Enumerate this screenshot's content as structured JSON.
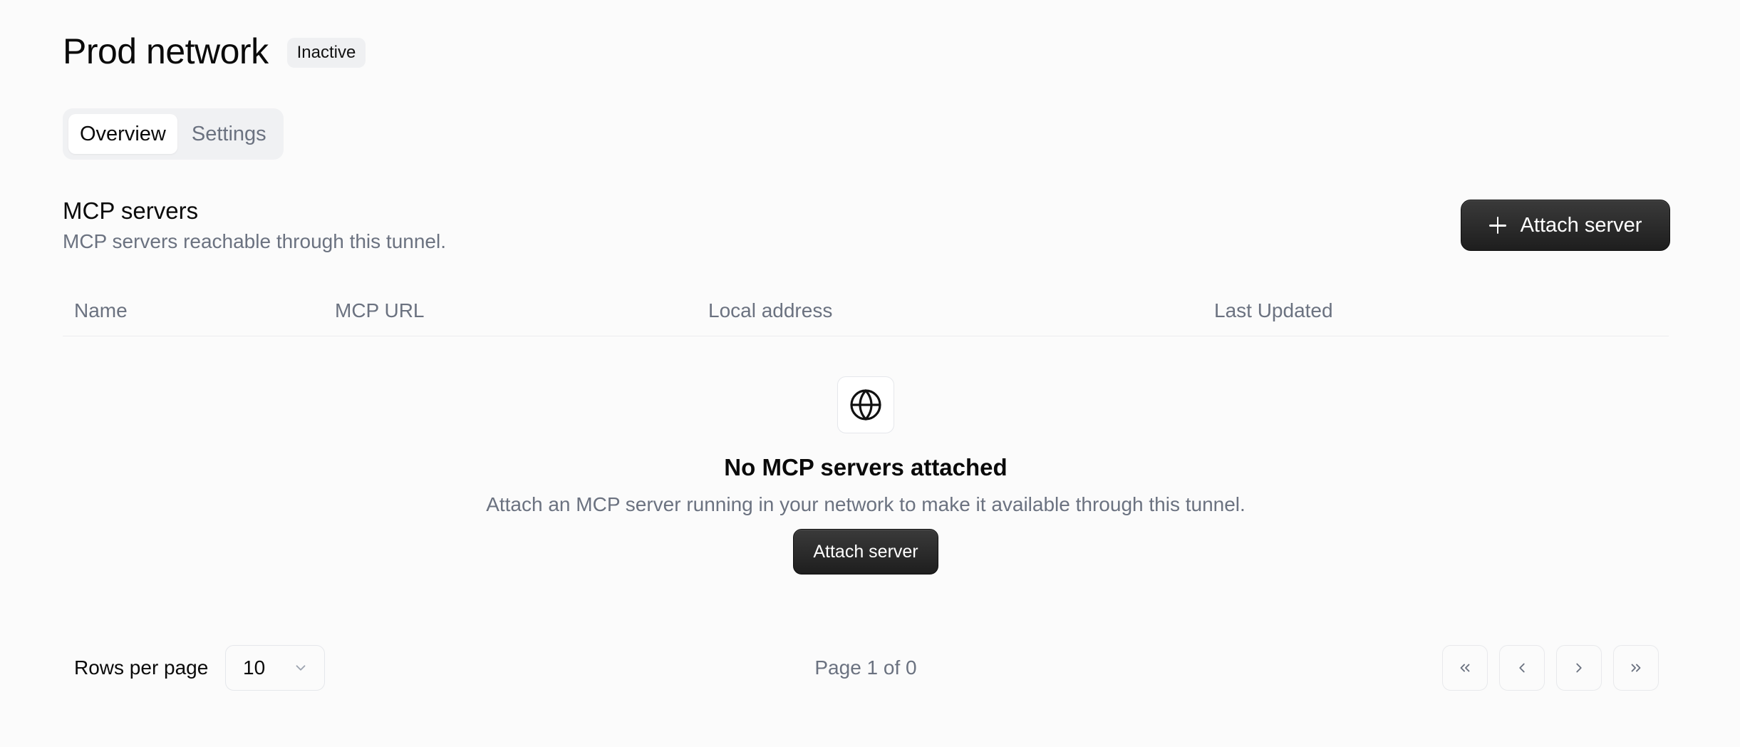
{
  "header": {
    "title": "Prod network",
    "status": "Inactive"
  },
  "tabs": [
    {
      "label": "Overview",
      "active": true
    },
    {
      "label": "Settings",
      "active": false
    }
  ],
  "section": {
    "title": "MCP servers",
    "subtitle": "MCP servers reachable through this tunnel.",
    "attach_label": "Attach server"
  },
  "table": {
    "columns": [
      "Name",
      "MCP URL",
      "Local address",
      "Last Updated"
    ],
    "rows": []
  },
  "empty_state": {
    "icon": "globe-icon",
    "title": "No MCP servers attached",
    "description": "Attach an MCP server running in your network to make it available through this tunnel.",
    "button_label": "Attach server"
  },
  "pagination": {
    "rows_label": "Rows per page",
    "rows_value": "10",
    "page_info": "Page 1 of 0"
  },
  "colors": {
    "background": "#fbfbfb",
    "primary_button": "#262626",
    "muted_text": "#6b7280"
  }
}
